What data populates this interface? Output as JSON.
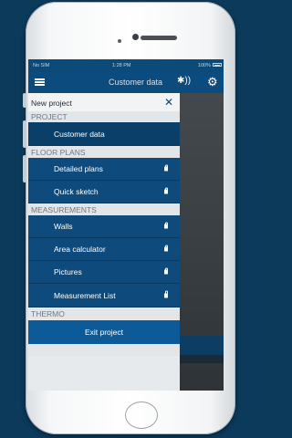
{
  "status_bar": {
    "carrier": "No SIM",
    "time": "1:28 PM",
    "right": "100%"
  },
  "navbar": {
    "title": "Customer data",
    "bluetooth_icon": "bluetooth-icon",
    "settings_icon": "gear-icon"
  },
  "drawer": {
    "title": "New project",
    "close_icon": "close-icon",
    "sections": {
      "project": "PROJECT",
      "floor_plans": "FLOOR PLANS",
      "measurements": "MEASUREMENTS",
      "thermo": "THERMO"
    },
    "items": {
      "customer_data": "Customer data",
      "detailed_plans": "Detailed plans",
      "quick_sketch": "Quick sketch",
      "walls": "Walls",
      "area_calculator": "Area calculator",
      "pictures": "Pictures",
      "measurement_list": "Measurement List"
    },
    "exit_label": "Exit project"
  },
  "colors": {
    "background": "#0b3a5b",
    "accent": "#0e4a7b",
    "exit": "#0d5a98"
  }
}
